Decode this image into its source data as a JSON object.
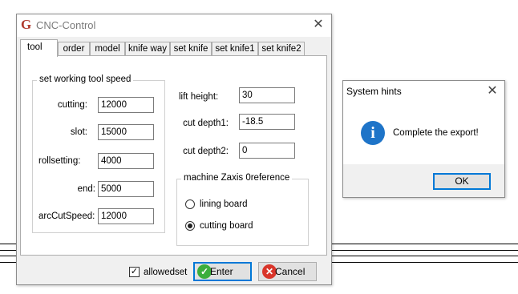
{
  "main_window": {
    "title": "CNC-Control",
    "app_icon": "G",
    "close_glyph": "✕",
    "tabs": [
      {
        "label": "tool",
        "active": true
      },
      {
        "label": "order"
      },
      {
        "label": "model"
      },
      {
        "label": "knife way"
      },
      {
        "label": "set knife"
      },
      {
        "label": "set knife1"
      },
      {
        "label": "set knife2"
      }
    ],
    "speed_group": {
      "title": "set working tool speed",
      "fields": [
        {
          "label": "cutting:",
          "value": "12000"
        },
        {
          "label": "slot:",
          "value": "15000"
        },
        {
          "label": "rollsetting:",
          "value": "4000"
        },
        {
          "label": "end:",
          "value": "5000"
        },
        {
          "label": "arcCutSpeed:",
          "value": "12000"
        }
      ]
    },
    "lift": {
      "fields": [
        {
          "label": "lift height:",
          "value": "30"
        },
        {
          "label": "cut depth1:",
          "value": "-18.5"
        },
        {
          "label": "cut depth2:",
          "value": "0"
        }
      ]
    },
    "zaxis_group": {
      "title": "machine Zaxis 0reference",
      "options": [
        {
          "label": "lining board",
          "selected": false
        },
        {
          "label": "cutting board",
          "selected": true
        }
      ]
    },
    "footer": {
      "checkbox_label": "allowedset",
      "checkbox_checked": true,
      "check_glyph": "✓",
      "enter_label": "Enter",
      "cancel_label": "Cancel",
      "enter_icon_color": "#3cae3c",
      "cancel_icon_color": "#d9352a",
      "enter_icon_glyph": "✓",
      "cancel_icon_glyph": "✕"
    }
  },
  "dialog": {
    "title": "System hints",
    "close_glyph": "✕",
    "icon": "information-icon",
    "icon_glyph": "i",
    "message": "Complete the export!",
    "ok_label": "OK"
  }
}
